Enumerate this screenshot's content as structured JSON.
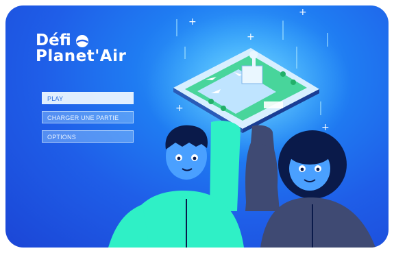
{
  "game": {
    "title_line1": "Défi",
    "title_line2": "Planet'Air"
  },
  "menu": {
    "items": [
      {
        "label": "PLAY",
        "active": true
      },
      {
        "label": "CHARGER UNE PARTIE",
        "active": false
      },
      {
        "label": "OPTIONS",
        "active": false
      }
    ]
  },
  "colors": {
    "background_top": "#3fb4ff",
    "background_bottom": "#1b46d6",
    "boy_skin": "#4aa0ff",
    "boy_shirt": "#2ff0c6",
    "girl_shirt": "#3f4a73",
    "hair": "#0a1a4a"
  },
  "icons": [
    "planet-logo-icon",
    "sparkle-icon"
  ]
}
